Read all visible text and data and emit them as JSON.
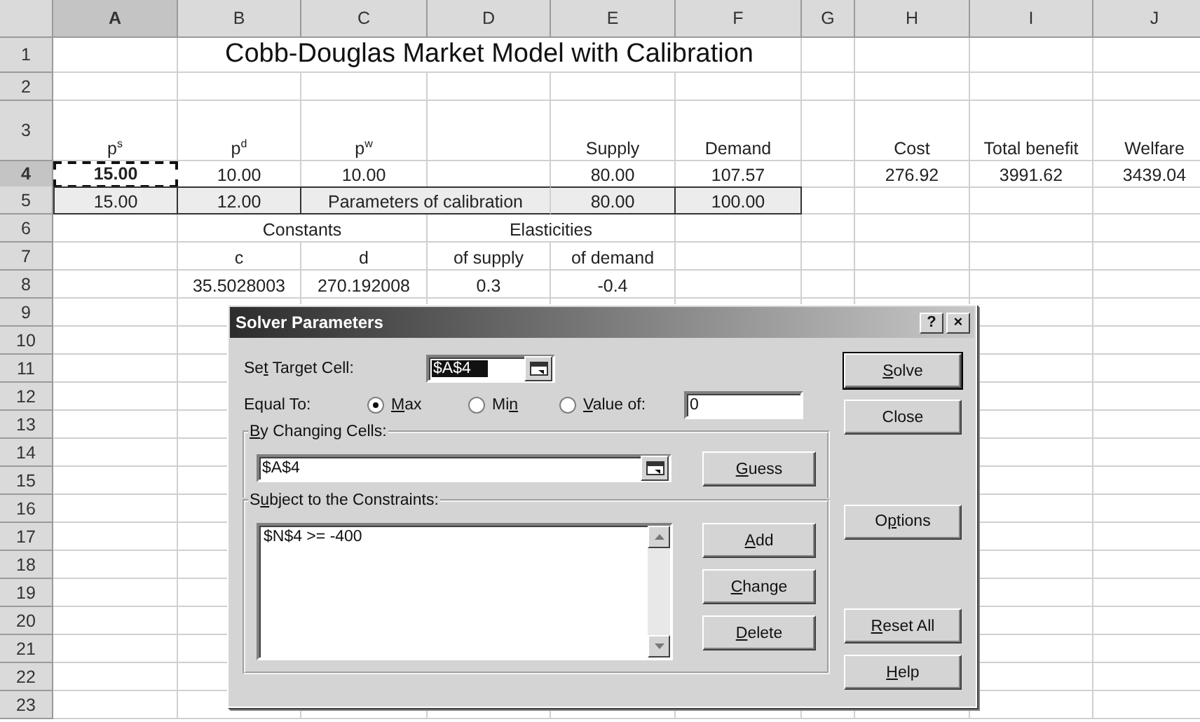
{
  "columns": [
    {
      "label": "A",
      "active": true
    },
    {
      "label": "B",
      "active": false
    },
    {
      "label": "C",
      "active": false
    },
    {
      "label": "D",
      "active": false
    },
    {
      "label": "E",
      "active": false
    },
    {
      "label": "F",
      "active": false
    },
    {
      "label": "G",
      "active": false
    },
    {
      "label": "H",
      "active": false
    },
    {
      "label": "I",
      "active": false
    },
    {
      "label": "J",
      "active": false
    }
  ],
  "rows": [
    {
      "label": "1",
      "active": false,
      "cells": [
        {
          "kind": "blank"
        },
        {
          "kind": "title",
          "text": "Cobb-Douglas Market Model with Calibration"
        },
        {
          "kind": "covered"
        },
        {
          "kind": "covered"
        },
        {
          "kind": "covered"
        },
        {
          "kind": "covered"
        }
      ]
    },
    {
      "label": "2",
      "active": false
    },
    {
      "label": "3",
      "active": false,
      "cells": [
        {
          "kind": "text",
          "text": "p$^{s}$"
        },
        {
          "kind": "text",
          "text": "p$^{d}$"
        },
        {
          "kind": "text",
          "text": "p$^{w}$"
        },
        {
          "kind": "blank"
        },
        {
          "kind": "text",
          "text": "Supply"
        },
        {
          "kind": "text",
          "text": "Demand"
        },
        {
          "kind": "blank"
        },
        {
          "kind": "text",
          "text": "Cost"
        },
        {
          "kind": "text",
          "text": "Total benefit"
        },
        {
          "kind": "text",
          "text": "Welfare"
        }
      ]
    },
    {
      "label": "4",
      "active": true,
      "cells": [
        {
          "kind": "text",
          "text": "15.00",
          "marquee": true
        },
        {
          "kind": "text",
          "text": "10.00"
        },
        {
          "kind": "text",
          "text": "10.00"
        },
        {
          "kind": "blank"
        },
        {
          "kind": "text",
          "text": "80.00"
        },
        {
          "kind": "text",
          "text": "107.57"
        },
        {
          "kind": "blank"
        },
        {
          "kind": "text",
          "text": "276.92"
        },
        {
          "kind": "text",
          "text": "3991.62"
        },
        {
          "kind": "text",
          "text": "3439.04"
        }
      ]
    },
    {
      "label": "5",
      "active": false,
      "outlined": true,
      "cells": [
        {
          "kind": "text",
          "text": "15.00"
        },
        {
          "kind": "text",
          "text": "12.00"
        },
        {
          "kind": "text",
          "text": "Parameters of calibration"
        },
        {
          "kind": "covered"
        },
        {
          "kind": "text",
          "text": "80.00"
        },
        {
          "kind": "text",
          "text": "100.00"
        }
      ]
    },
    {
      "label": "6",
      "active": false,
      "cells": [
        {
          "kind": "blank"
        },
        {
          "kind": "text",
          "text": "Constants"
        },
        {
          "kind": "covered"
        },
        {
          "kind": "text",
          "text": "Elasticities"
        },
        {
          "kind": "covered"
        }
      ]
    },
    {
      "label": "7",
      "active": false,
      "cells": [
        {
          "kind": "blank"
        },
        {
          "kind": "text",
          "text": "c"
        },
        {
          "kind": "text",
          "text": "d"
        },
        {
          "kind": "text",
          "text": "of supply"
        },
        {
          "kind": "text",
          "text": "of demand"
        }
      ]
    },
    {
      "label": "8",
      "active": false,
      "cells": [
        {
          "kind": "blank"
        },
        {
          "kind": "text",
          "text": "35.5028003"
        },
        {
          "kind": "text",
          "text": "270.192008"
        },
        {
          "kind": "text",
          "text": "0.3"
        },
        {
          "kind": "text",
          "text": "-0.4"
        }
      ]
    },
    {
      "label": "9",
      "active": false
    },
    {
      "label": "10",
      "active": false
    },
    {
      "label": "11",
      "active": false
    },
    {
      "label": "12",
      "active": false
    },
    {
      "label": "13",
      "active": false
    },
    {
      "label": "14",
      "active": false
    },
    {
      "label": "15",
      "active": false
    },
    {
      "label": "16",
      "active": false
    },
    {
      "label": "17",
      "active": false
    },
    {
      "label": "18",
      "active": false
    },
    {
      "label": "19",
      "active": false
    },
    {
      "label": "20",
      "active": false
    },
    {
      "label": "21",
      "active": false
    },
    {
      "label": "22",
      "active": false
    },
    {
      "label": "23",
      "active": false
    }
  ],
  "dialog": {
    "title": "Solver Parameters",
    "help_button": "?",
    "close_button": "×",
    "target": {
      "label": {
        "pre": "Se",
        "key": "t",
        "post": " Target Cell:"
      },
      "value": "$A$4"
    },
    "equal_to": {
      "label": "Equal To:",
      "value": "0",
      "options": [
        {
          "label": {
            "key": "M",
            "post": "ax"
          },
          "selected": true
        },
        {
          "label": {
            "pre": "Mi",
            "key": "n"
          },
          "selected": false
        },
        {
          "label": {
            "key": "V",
            "post": "alue of:"
          },
          "selected": false
        }
      ]
    },
    "changing": {
      "label": {
        "key": "B",
        "post": "y Changing Cells:"
      },
      "value": "$A$4",
      "button": {
        "key": "G",
        "post": "uess"
      }
    },
    "constraints": {
      "label": {
        "pre": "S",
        "key": "u",
        "post": "bject to the Constraints:"
      },
      "items": [
        "$N$4 >= -400"
      ],
      "buttons": [
        {
          "key": "A",
          "post": "dd"
        },
        {
          "key": "C",
          "post": "hange"
        },
        {
          "key": "D",
          "post": "elete"
        }
      ]
    },
    "side_buttons": [
      [
        {
          "label": {
            "key": "S",
            "post": "olve"
          },
          "default": true
        },
        {
          "label": {
            "pre": "Close"
          },
          "default": false
        }
      ],
      [
        {
          "label": {
            "pre": "O",
            "key": "p",
            "post": "tions"
          },
          "default": false
        }
      ],
      [
        {
          "label": {
            "key": "R",
            "post": "eset All"
          },
          "default": false
        },
        {
          "label": {
            "key": "H",
            "post": "elp"
          },
          "default": false
        }
      ]
    ]
  }
}
